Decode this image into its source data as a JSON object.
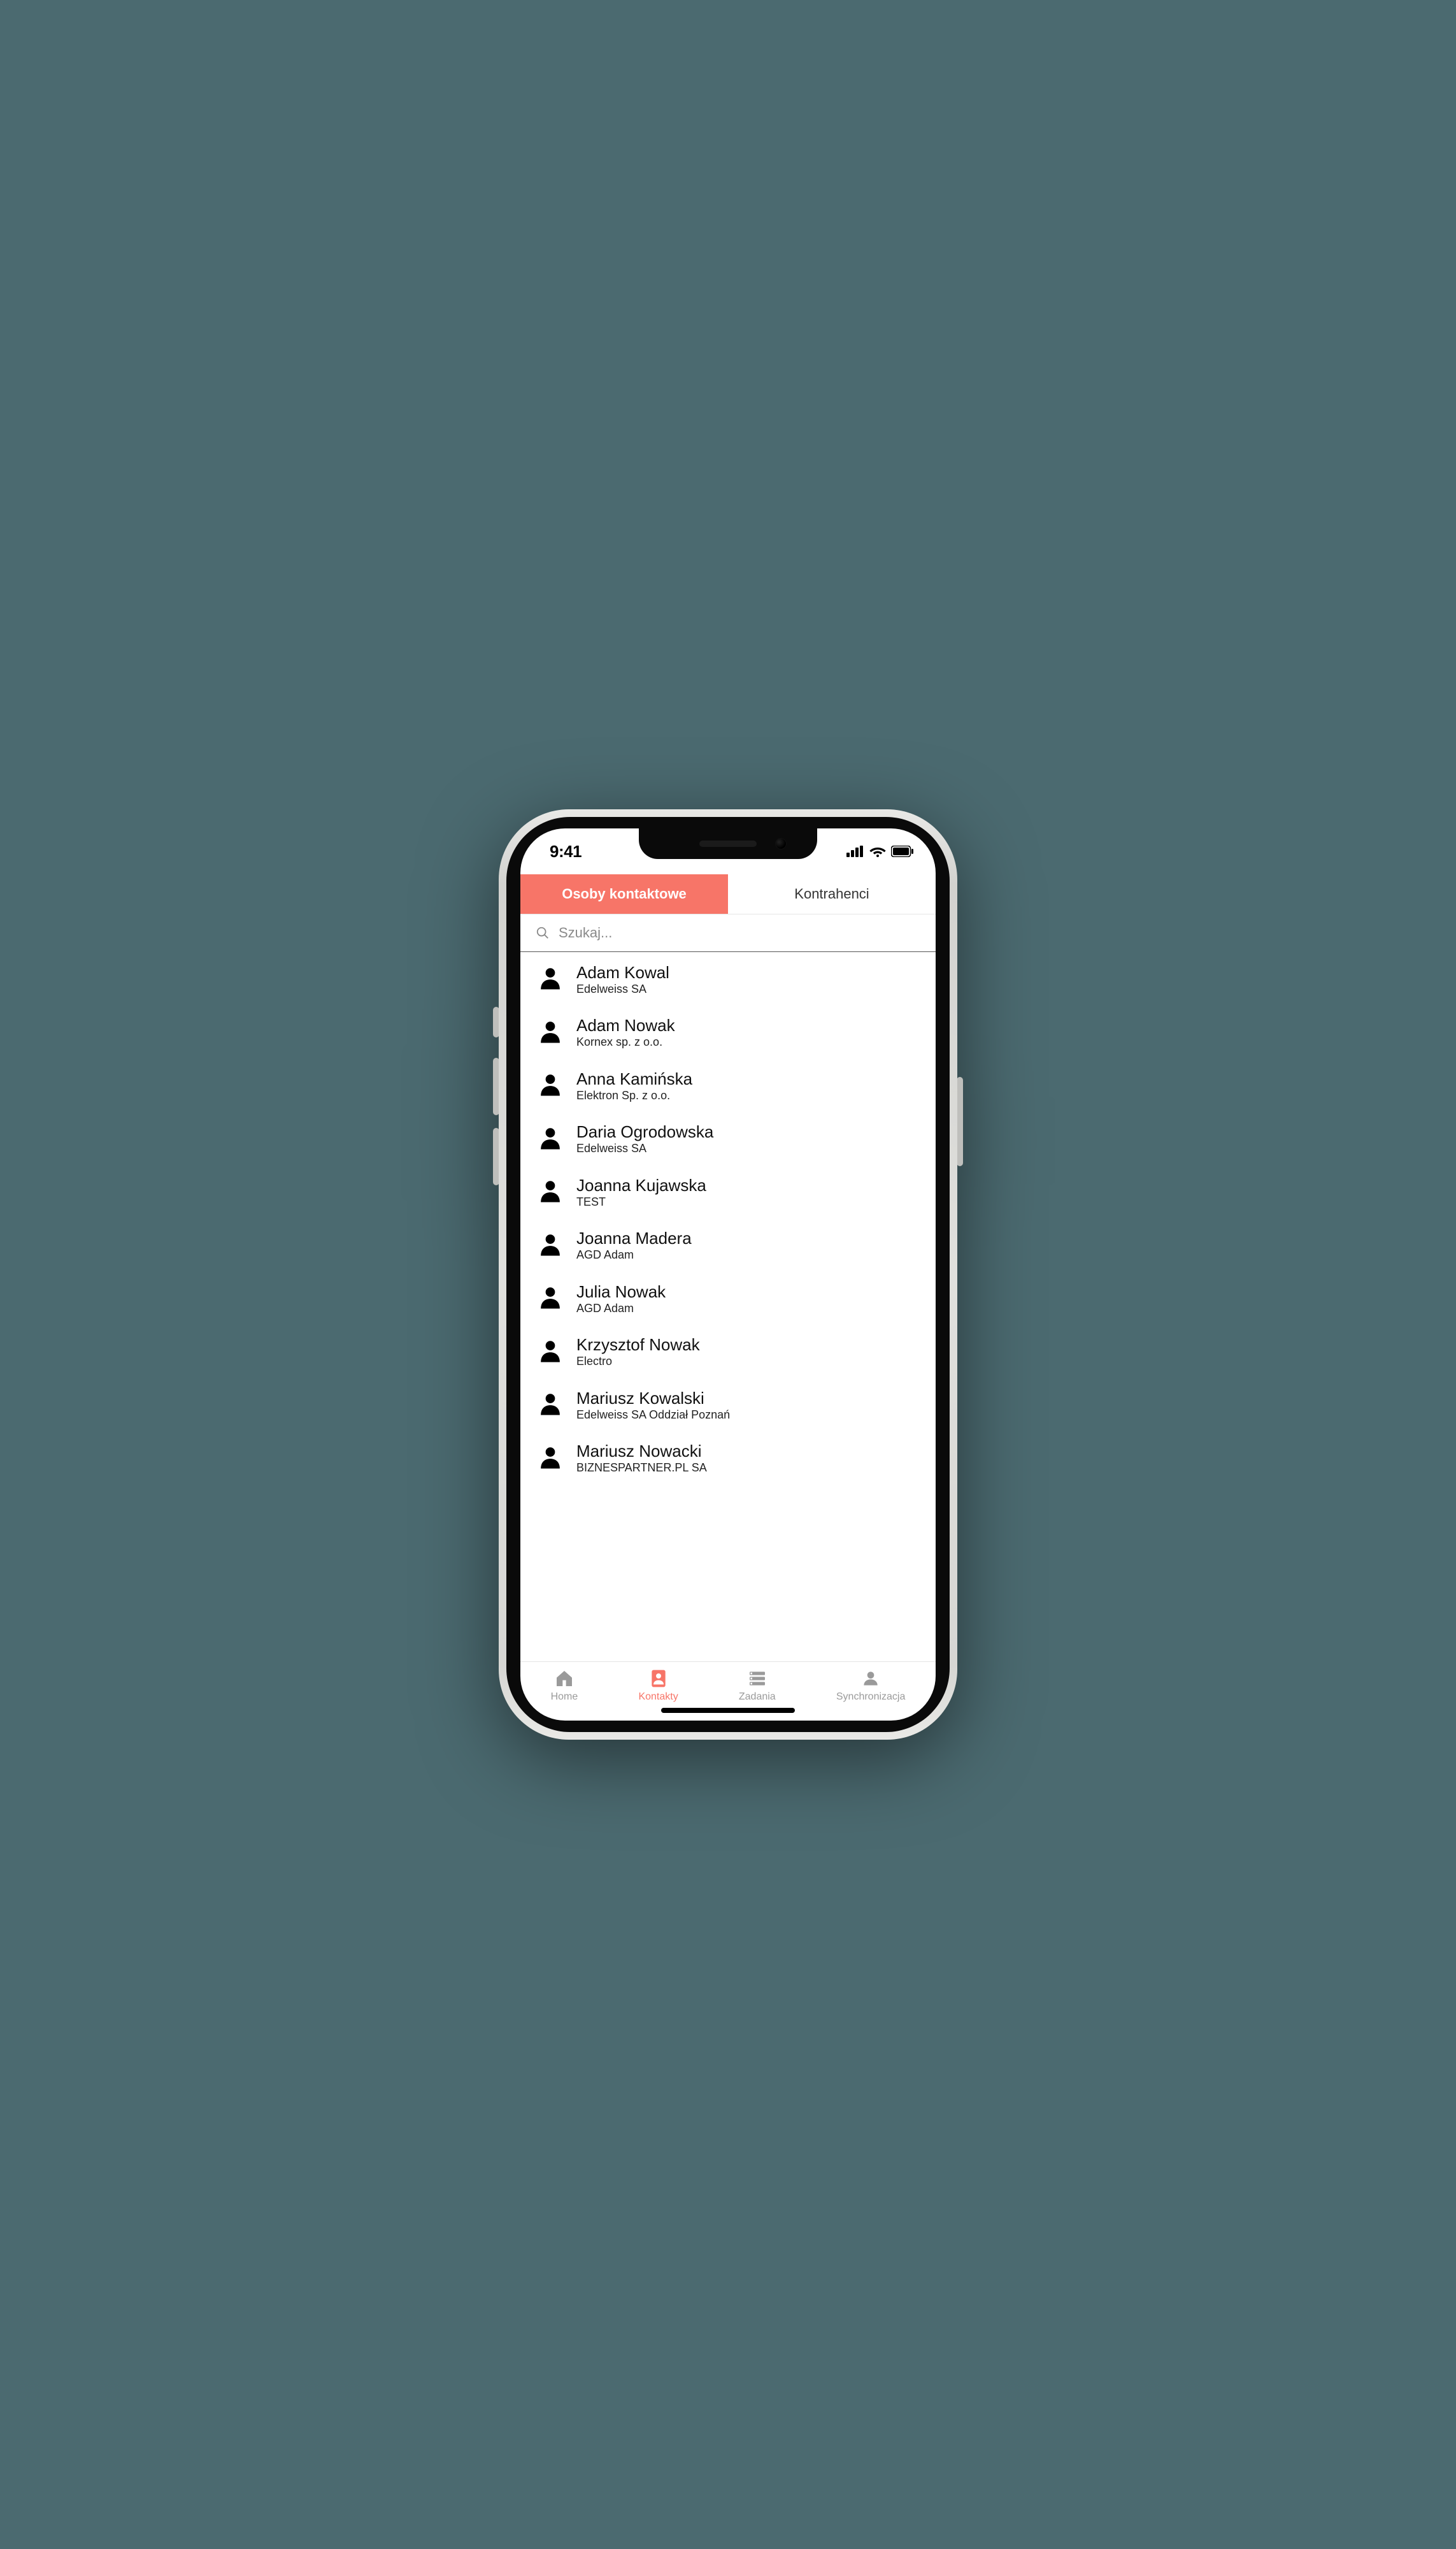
{
  "status": {
    "time": "9:41"
  },
  "tabs": {
    "contacts": "Osoby kontaktowe",
    "contractors": "Kontrahenci"
  },
  "search": {
    "placeholder": "Szukaj..."
  },
  "contacts": [
    {
      "name": "Adam Kowal",
      "company": "Edelweiss SA"
    },
    {
      "name": "Adam Nowak",
      "company": "Kornex sp. z o.o."
    },
    {
      "name": "Anna Kamińska",
      "company": "Elektron Sp. z o.o."
    },
    {
      "name": "Daria Ogrodowska",
      "company": "Edelweiss SA"
    },
    {
      "name": "Joanna Kujawska",
      "company": "TEST"
    },
    {
      "name": "Joanna Madera",
      "company": "AGD Adam"
    },
    {
      "name": "Julia Nowak",
      "company": "AGD Adam"
    },
    {
      "name": "Krzysztof  Nowak",
      "company": "Electro"
    },
    {
      "name": "Mariusz Kowalski",
      "company": "Edelweiss SA Oddział Poznań"
    },
    {
      "name": "Mariusz  Nowacki",
      "company": "BIZNESPARTNER.PL SA"
    }
  ],
  "nav": {
    "home": "Home",
    "contacts": "Kontakty",
    "tasks": "Zadania",
    "sync": "Synchronizacja"
  },
  "colors": {
    "accent": "#f77568",
    "background": "#4b6a70"
  }
}
